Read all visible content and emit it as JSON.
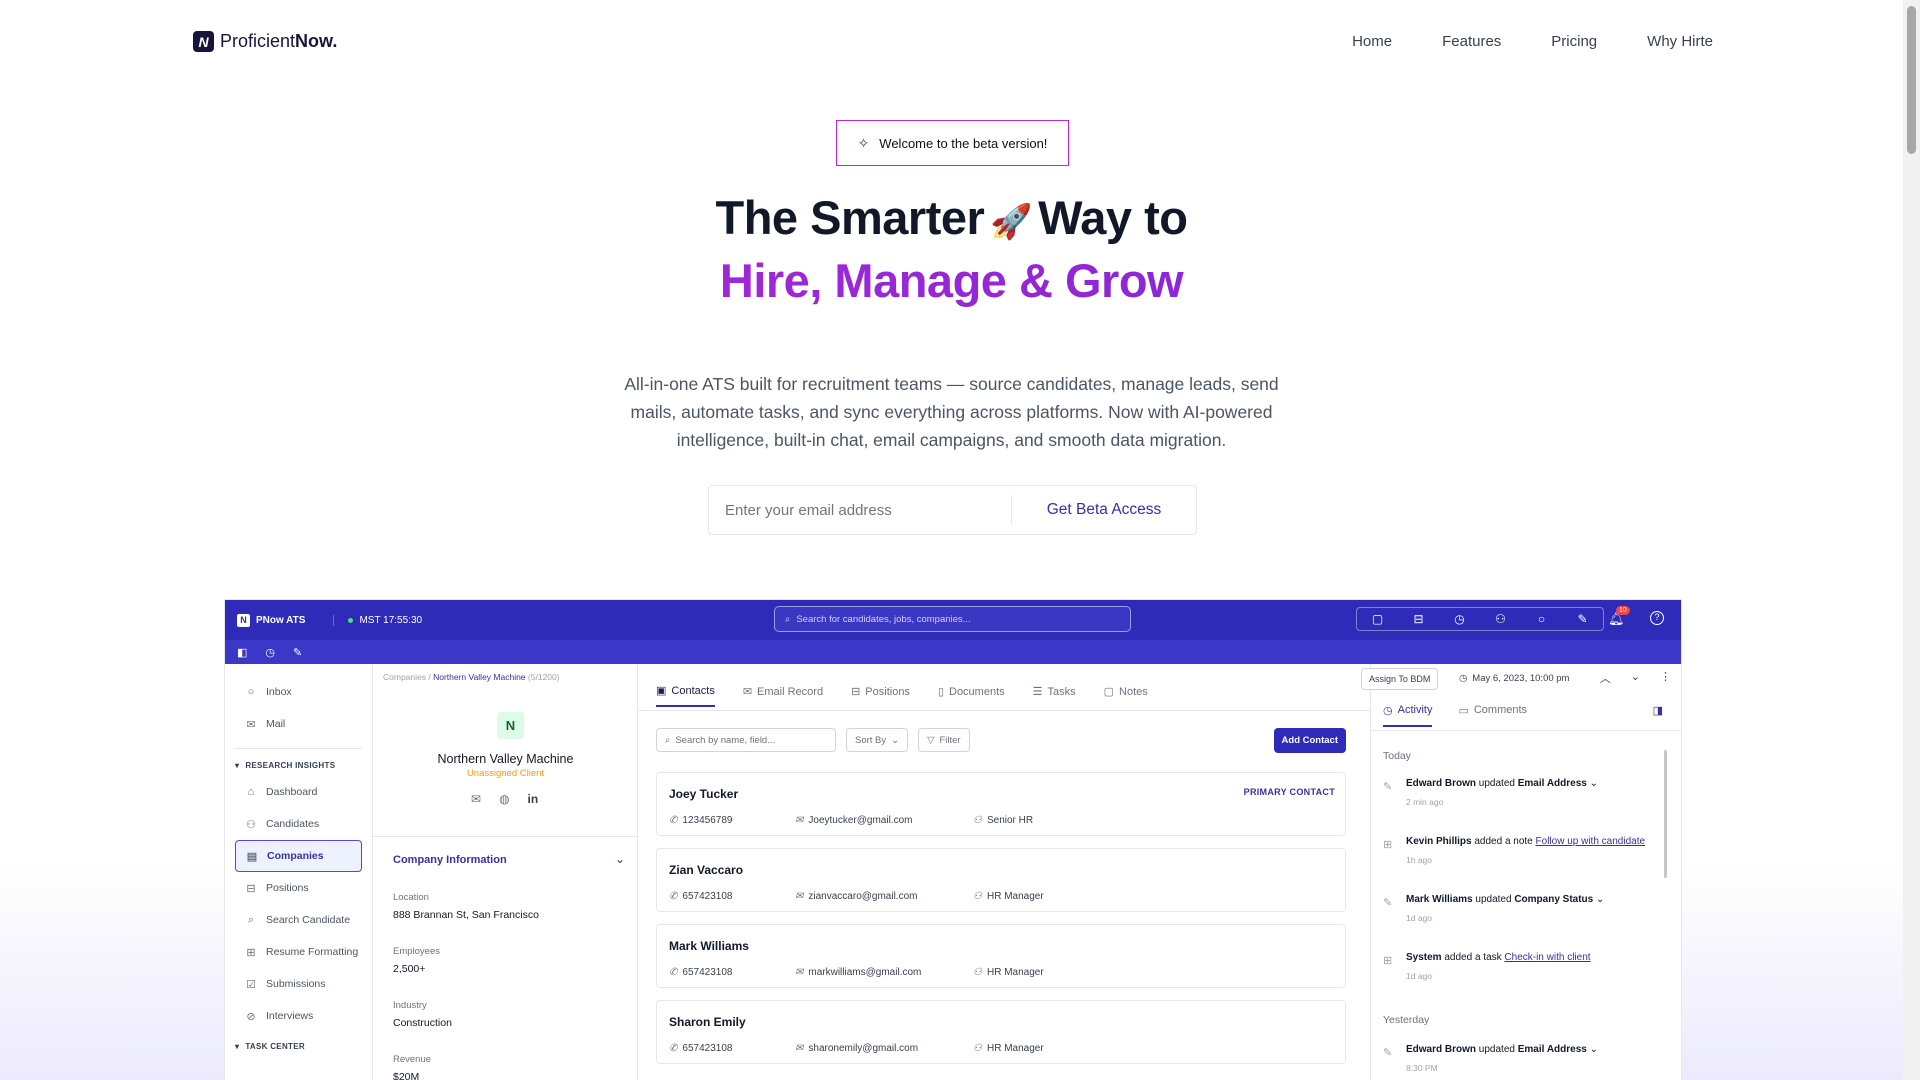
{
  "brand": {
    "name_light": "Proficient",
    "name_bold": "Now."
  },
  "nav": [
    "Home",
    "Features",
    "Pricing",
    "Why Hirte"
  ],
  "badge": "Welcome to the beta version!",
  "hero": {
    "line1_a": "The Smarter",
    "line1_b": "Way to",
    "line2": "Hire, Manage & Grow"
  },
  "description": "All-in-one ATS built for recruitment teams — source candidates, manage leads, send mails, automate tasks, and sync everything across platforms. Now with AI-powered intelligence, built-in chat, email campaigns, and smooth data migration.",
  "form": {
    "placeholder": "Enter your email address",
    "button": "Get Beta Access"
  },
  "app": {
    "brand": "PNow ATS",
    "clock": "MST 17:55:30",
    "search_placeholder": "Search for candidates, jobs, companies...",
    "notif_count": "10",
    "sidebar_top": [
      "Inbox",
      "Mail"
    ],
    "section_research": "RESEARCH INSIGHTS",
    "sidebar_items": [
      "Dashboard",
      "Candidates",
      "Companies",
      "Positions",
      "Search Candidate",
      "Resume Formatting",
      "Submissions",
      "Interviews"
    ],
    "section_task": "TASK CENTER",
    "breadcrumb": {
      "root": "Companies",
      "current": "Northern Valley Machine",
      "count": "(5/1200)"
    },
    "company": {
      "initial": "N",
      "name": "Northern Valley Machine",
      "status": "Unassigned Client",
      "section": "Company Information",
      "fields": [
        {
          "label": "Location",
          "value": "888 Brannan St, San Francisco"
        },
        {
          "label": "Employees",
          "value": "2,500+"
        },
        {
          "label": "Industry",
          "value": "Construction"
        },
        {
          "label": "Revenue",
          "value": "$20M"
        }
      ]
    },
    "tabs": [
      "Contacts",
      "Email Record",
      "Positions",
      "Documents",
      "Tasks",
      "Notes"
    ],
    "tools": {
      "search": "Search by name, field...",
      "sort": "Sort By",
      "filter": "Filter",
      "add": "Add Contact"
    },
    "contacts": [
      {
        "name": "Joey Tucker",
        "phone": "123456789",
        "email": "Joeytucker@gmail.com",
        "role": "Senior HR",
        "tag": "PRIMARY CONTACT"
      },
      {
        "name": "Zian Vaccaro",
        "phone": "657423108",
        "email": "zianvaccaro@gmail.com",
        "role": "HR Manager",
        "tag": ""
      },
      {
        "name": "Mark Williams",
        "phone": "657423108",
        "email": "markwilliams@gmail.com",
        "role": "HR Manager",
        "tag": ""
      },
      {
        "name": "Sharon Emily",
        "phone": "657423108",
        "email": "sharonemily@gmail.com",
        "role": "HR Manager",
        "tag": ""
      }
    ],
    "assign": "Assign To BDM",
    "date": "May 6, 2023, 10:00 pm",
    "activity_tabs": [
      "Activity",
      "Comments"
    ],
    "today": "Today",
    "yesterday": "Yesterday",
    "events": [
      {
        "who": "Edward Brown",
        "action": "updated",
        "target": "Email Address",
        "link": "",
        "ago": "2 min ago"
      },
      {
        "who": "Kevin Phillips",
        "action": "added a note",
        "target": "",
        "link": "Follow up with candidate",
        "ago": "1h ago"
      },
      {
        "who": "Mark Williams",
        "action": "updated",
        "target": "Company Status",
        "link": "",
        "ago": "1d ago"
      },
      {
        "who": "System",
        "action": "added a task",
        "target": "",
        "link": "Check-in with client",
        "ago": "1d ago"
      },
      {
        "who": "Edward Brown",
        "action": "updated",
        "target": "Email Address",
        "link": "",
        "ago": "8:30 PM"
      }
    ]
  }
}
